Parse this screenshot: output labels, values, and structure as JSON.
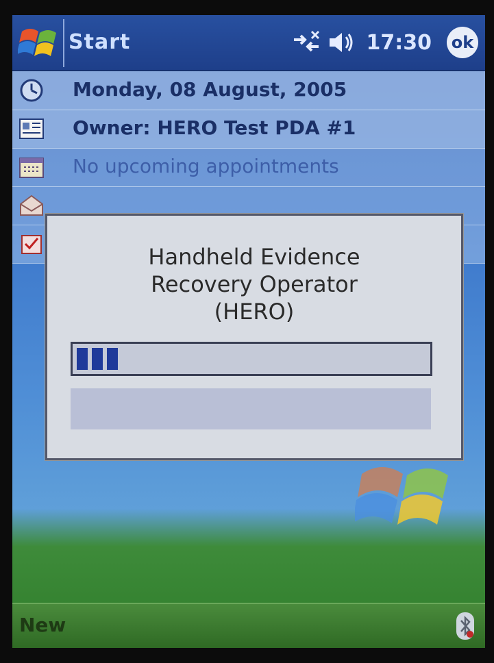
{
  "titlebar": {
    "start_label": "Start",
    "time": "17:30",
    "ok_label": "ok"
  },
  "today": {
    "items": [
      {
        "icon": "clock-icon",
        "text": "Monday, 08 August, 2005"
      },
      {
        "icon": "owner-card-icon",
        "text": "Owner: HERO Test PDA #1"
      },
      {
        "icon": "calendar-icon",
        "text": "No upcoming appointments"
      }
    ]
  },
  "dialog": {
    "title_line1": "Handheld Evidence",
    "title_line2": "Recovery Operator",
    "title_line3": "(HERO)",
    "progress": 0.1
  },
  "menubar": {
    "left_softkey": "New"
  },
  "colors": {
    "titlebar": "#1e3f8a",
    "progress_fill": "#1f3a9a",
    "menubar": "#2f6a24"
  }
}
